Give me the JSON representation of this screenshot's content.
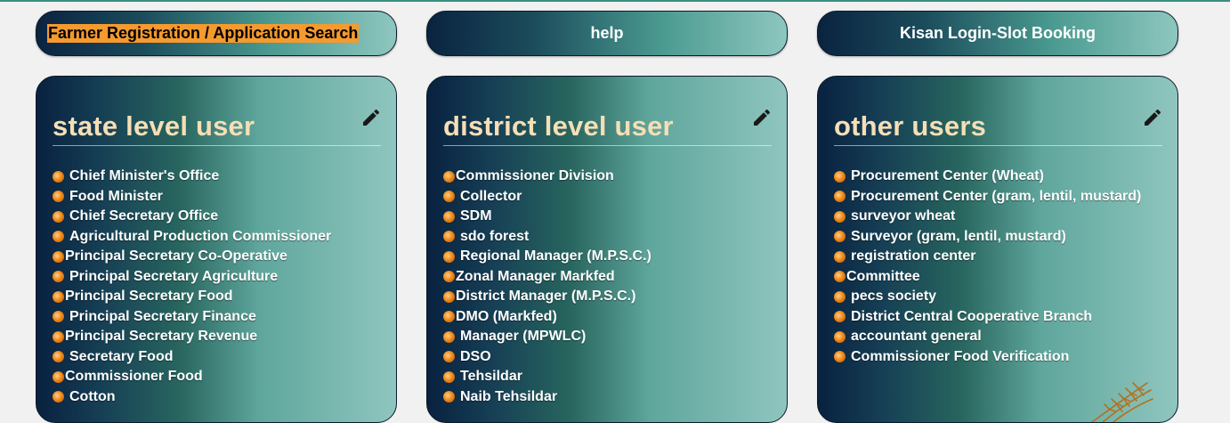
{
  "top_buttons": {
    "farmer_registration": "Farmer Registration / Application Search",
    "help": "help",
    "kisan_login": "Kisan Login-Slot Booking"
  },
  "colors": {
    "title_text": "#f6deb6",
    "highlight": "#f59a2e",
    "bullet": "#f08a1a"
  },
  "cards": {
    "state": {
      "title": "state level user",
      "icon": "pencil-icon",
      "items": [
        "Chief Minister's Office",
        "Food Minister",
        "Chief Secretary Office",
        "Agricultural Production Commissioner",
        "Principal Secretary Co-Operative",
        "Principal Secretary Agriculture",
        "Principal Secretary Food",
        "Principal Secretary Finance",
        "Principal Secretary Revenue",
        "Secretary Food",
        "Commissioner Food",
        "Cotton"
      ]
    },
    "district": {
      "title": "district level user",
      "icon": "pencil-icon",
      "items": [
        "Commissioner Division",
        "Collector",
        "SDM",
        "sdo forest",
        "Regional Manager (M.P.S.C.)",
        "Zonal Manager Markfed",
        "District Manager (M.P.S.C.)",
        "DMO (Markfed)",
        "Manager (MPWLC)",
        "DSO",
        "Tehsildar",
        "Naib Tehsildar"
      ]
    },
    "other": {
      "title": "other users",
      "icon": "pencil-icon",
      "items": [
        "Procurement Center (Wheat)",
        "Procurement Center (gram, lentil, mustard)",
        "surveyor wheat",
        "Surveyor (gram, lentil, mustard)",
        "registration center",
        "Committee",
        "pecs society",
        "District Central Cooperative Branch",
        "accountant general",
        "Commissioner Food Verification"
      ]
    }
  }
}
